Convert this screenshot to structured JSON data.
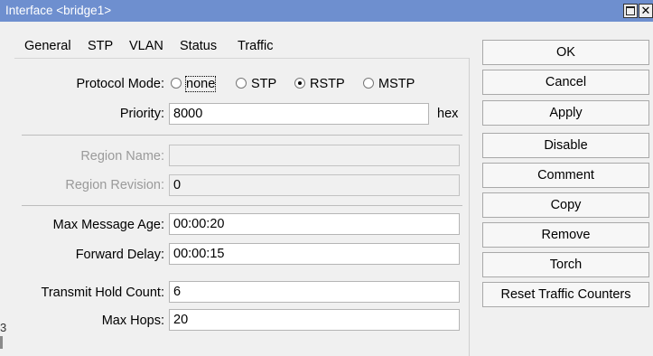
{
  "window": {
    "title": "Interface <bridge1>",
    "close_glyph": "✕"
  },
  "tabs": [
    {
      "label": "General"
    },
    {
      "label": "STP"
    },
    {
      "label": "VLAN"
    },
    {
      "label": "Status"
    },
    {
      "label": "Traffic"
    }
  ],
  "stp": {
    "protocol_mode": {
      "label": "Protocol Mode:",
      "options": [
        {
          "label": "none",
          "selected": false
        },
        {
          "label": "STP",
          "selected": false
        },
        {
          "label": "RSTP",
          "selected": true
        },
        {
          "label": "MSTP",
          "selected": false
        }
      ]
    },
    "priority": {
      "label": "Priority:",
      "value": "8000",
      "unit": "hex"
    },
    "region_name": {
      "label": "Region Name:",
      "value": ""
    },
    "region_revision": {
      "label": "Region Revision:",
      "value": "0"
    },
    "max_message_age": {
      "label": "Max Message Age:",
      "value": "00:00:20"
    },
    "forward_delay": {
      "label": "Forward Delay:",
      "value": "00:00:15"
    },
    "transmit_hold_count": {
      "label": "Transmit Hold Count:",
      "value": "6"
    },
    "max_hops": {
      "label": "Max Hops:",
      "value": "20"
    }
  },
  "buttons": {
    "ok": "OK",
    "cancel": "Cancel",
    "apply": "Apply",
    "disable": "Disable",
    "comment": "Comment",
    "copy": "Copy",
    "remove": "Remove",
    "torch": "Torch",
    "reset_traffic_counters": "Reset Traffic Counters"
  },
  "background_fragment": "3"
}
